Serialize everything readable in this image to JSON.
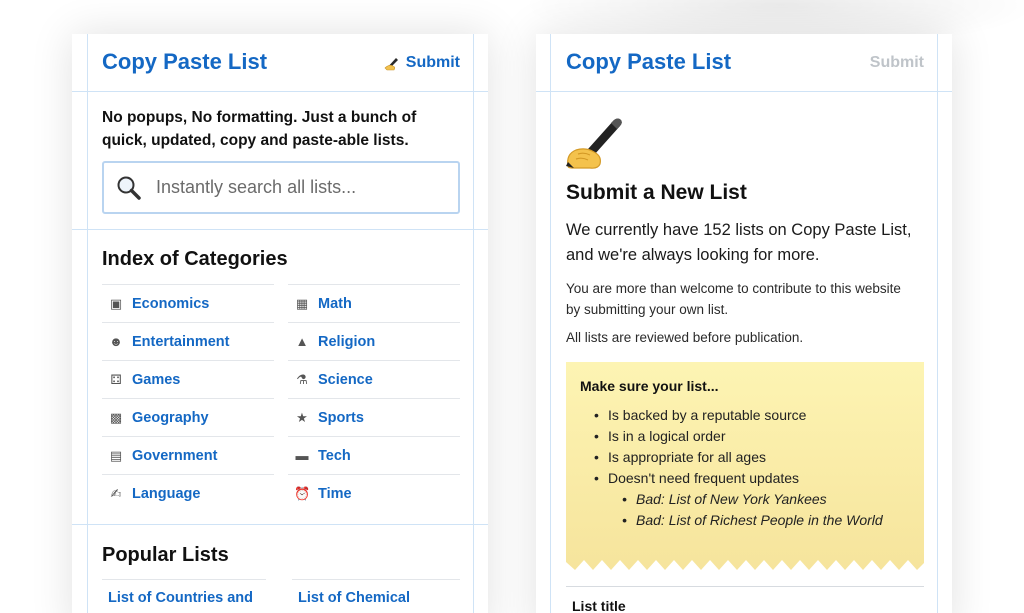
{
  "left_screen": {
    "header": {
      "title": "Copy Paste List",
      "submit_icon": "writing-hand-icon",
      "submit_label": "Submit"
    },
    "intro": "No popups, No formatting. Just a bunch of quick, updated, copy and paste-able lists.",
    "search": {
      "placeholder": "Instantly search all lists...",
      "icon": "magnifying-glass-icon"
    },
    "categories_heading": "Index of Categories",
    "categories": [
      {
        "icon": "money-icon",
        "label": "Economics"
      },
      {
        "icon": "abacus-icon",
        "label": "Math"
      },
      {
        "icon": "theater-masks-icon",
        "label": "Entertainment"
      },
      {
        "icon": "praying-hands-icon",
        "label": "Religion"
      },
      {
        "icon": "dice-icon",
        "label": "Games"
      },
      {
        "icon": "microscope-icon",
        "label": "Science"
      },
      {
        "icon": "world-map-icon",
        "label": "Geography"
      },
      {
        "icon": "medal-icon",
        "label": "Sports"
      },
      {
        "icon": "government-building-icon",
        "label": "Government"
      },
      {
        "icon": "laptop-icon",
        "label": "Tech"
      },
      {
        "icon": "writing-hand-icon",
        "label": "Language"
      },
      {
        "icon": "alarm-clock-icon",
        "label": "Time"
      }
    ],
    "popular_heading": "Popular Lists",
    "popular": [
      {
        "label": "List of Countries and"
      },
      {
        "label": "List of Chemical"
      }
    ]
  },
  "right_screen": {
    "header": {
      "title": "Copy Paste List",
      "submit_label": "Submit"
    },
    "hero_icon": "writing-hand-icon",
    "heading": "Submit a New List",
    "lead": "We currently have 152 lists on Copy Paste List, and we're always looking for more.",
    "para1": "You are more than welcome to contribute to this website by submitting your own list.",
    "para2": "All lists are reviewed before publication.",
    "note": {
      "title": "Make sure your list...",
      "items": [
        "Is backed by a reputable source",
        "Is in a logical order",
        "Is appropriate for all ages",
        "Doesn't need frequent updates"
      ],
      "sub_items": [
        "Bad: List of New York Yankees",
        "Bad: List of Richest People in the World"
      ]
    },
    "form": {
      "title_label": "List title"
    }
  },
  "colors": {
    "accent": "#1468c4",
    "guide_lines": "#cfe3f6",
    "note_bg": "#fdf4b3",
    "disabled": "#bfc4c9"
  }
}
